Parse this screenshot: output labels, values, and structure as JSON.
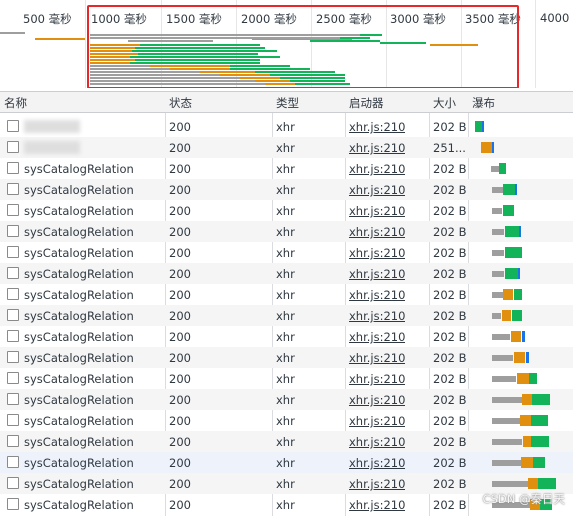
{
  "overview": {
    "ticks": [
      "500 毫秒",
      "1000 毫秒",
      "1500 毫秒",
      "2000 毫秒",
      "2500 毫秒",
      "3000 毫秒",
      "3500 毫秒",
      "4000"
    ]
  },
  "columns": {
    "name": "名称",
    "status": "状态",
    "type": "类型",
    "initiator": "启动器",
    "size": "大小",
    "waterfall": "瀑布"
  },
  "rows": [
    {
      "name": "",
      "status": "200",
      "type": "xhr",
      "initiator": "xhr.js:210",
      "size": "202 B"
    },
    {
      "name": "",
      "status": "200",
      "type": "xhr",
      "initiator": "xhr.js:210",
      "size": "251..."
    },
    {
      "name": "sysCatalogRelation",
      "status": "200",
      "type": "xhr",
      "initiator": "xhr.js:210",
      "size": "202 B"
    },
    {
      "name": "sysCatalogRelation",
      "status": "200",
      "type": "xhr",
      "initiator": "xhr.js:210",
      "size": "202 B"
    },
    {
      "name": "sysCatalogRelation",
      "status": "200",
      "type": "xhr",
      "initiator": "xhr.js:210",
      "size": "202 B"
    },
    {
      "name": "sysCatalogRelation",
      "status": "200",
      "type": "xhr",
      "initiator": "xhr.js:210",
      "size": "202 B"
    },
    {
      "name": "sysCatalogRelation",
      "status": "200",
      "type": "xhr",
      "initiator": "xhr.js:210",
      "size": "202 B"
    },
    {
      "name": "sysCatalogRelation",
      "status": "200",
      "type": "xhr",
      "initiator": "xhr.js:210",
      "size": "202 B"
    },
    {
      "name": "sysCatalogRelation",
      "status": "200",
      "type": "xhr",
      "initiator": "xhr.js:210",
      "size": "202 B"
    },
    {
      "name": "sysCatalogRelation",
      "status": "200",
      "type": "xhr",
      "initiator": "xhr.js:210",
      "size": "202 B"
    },
    {
      "name": "sysCatalogRelation",
      "status": "200",
      "type": "xhr",
      "initiator": "xhr.js:210",
      "size": "202 B"
    },
    {
      "name": "sysCatalogRelation",
      "status": "200",
      "type": "xhr",
      "initiator": "xhr.js:210",
      "size": "202 B"
    },
    {
      "name": "sysCatalogRelation",
      "status": "200",
      "type": "xhr",
      "initiator": "xhr.js:210",
      "size": "202 B"
    },
    {
      "name": "sysCatalogRelation",
      "status": "200",
      "type": "xhr",
      "initiator": "xhr.js:210",
      "size": "202 B"
    },
    {
      "name": "sysCatalogRelation",
      "status": "200",
      "type": "xhr",
      "initiator": "xhr.js:210",
      "size": "202 B"
    },
    {
      "name": "sysCatalogRelation",
      "status": "200",
      "type": "xhr",
      "initiator": "xhr.js:210",
      "size": "202 B"
    },
    {
      "name": "sysCatalogRelation",
      "status": "200",
      "type": "xhr",
      "initiator": "xhr.js:210",
      "size": "202 B"
    },
    {
      "name": "sysCatalogRelation",
      "status": "200",
      "type": "xhr",
      "initiator": "xhr.js:210",
      "size": "202 B"
    },
    {
      "name": "sysCatalogRelation",
      "status": "200",
      "type": "xhr",
      "initiator": "xhr.js:210",
      "size": "202 B"
    }
  ],
  "colors": {
    "waiting": "#9e9e9e",
    "queueing": "#e0900e",
    "download": "#13b35a",
    "send": "#1a73e8",
    "selection": "#e8272b"
  },
  "watermark": "CSDN @秦日天"
}
